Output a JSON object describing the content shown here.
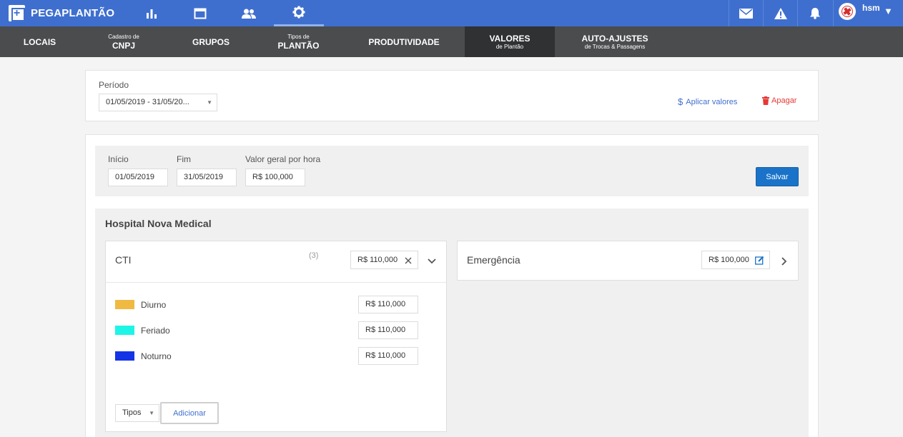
{
  "app": {
    "name": "PEGAPLANTÃO"
  },
  "top_nav": {
    "icons": [
      "chart-bar-icon",
      "window-icon",
      "people-icon",
      "gear-icon"
    ],
    "active": "gear-icon"
  },
  "user": {
    "name": "hsm"
  },
  "sub_nav": {
    "items": [
      {
        "big": "LOCAIS",
        "small": ""
      },
      {
        "small": "Cadastro de",
        "big": "CNPJ"
      },
      {
        "big": "GRUPOS",
        "small": ""
      },
      {
        "small": "Tipos de",
        "big": "PLANTÃO"
      },
      {
        "big": "PRODUTIVIDADE",
        "small": ""
      },
      {
        "big": "VALORES",
        "small": "de Plantão"
      },
      {
        "big": "AUTO-AJUSTES",
        "small": "de Trocas & Passagens"
      }
    ],
    "active": "VALORES"
  },
  "period": {
    "label": "Período",
    "value": "01/05/2019 - 31/05/20...",
    "apply_link": "Aplicar valores",
    "delete_link": "Apagar"
  },
  "form": {
    "start_label": "Início",
    "start_value": "01/05/2019",
    "end_label": "Fim",
    "end_value": "31/05/2019",
    "general_label": "Valor geral por hora",
    "general_value": "R$ 100,000",
    "save_label": "Salvar"
  },
  "hospital": {
    "name": "Hospital Nova Medical",
    "units": [
      {
        "name": "CTI",
        "count": "(3)",
        "value": "R$ 110,000",
        "types": [
          {
            "name": "Diurno",
            "color": "#f0b942",
            "value": "R$ 110,000"
          },
          {
            "name": "Feriado",
            "color": "#1ff5e6",
            "value": "R$ 110,000"
          },
          {
            "name": "Noturno",
            "color": "#1434e6",
            "value": "R$ 110,000"
          }
        ],
        "types_select": "Tipos",
        "add_label": "Adicionar"
      },
      {
        "name": "Emergência",
        "value": "R$ 100,000"
      }
    ]
  },
  "colors": {
    "brand": "#3f6fce",
    "subnav": "#4a4c4e",
    "primary_button": "#1a73c8",
    "danger": "#e53935"
  }
}
